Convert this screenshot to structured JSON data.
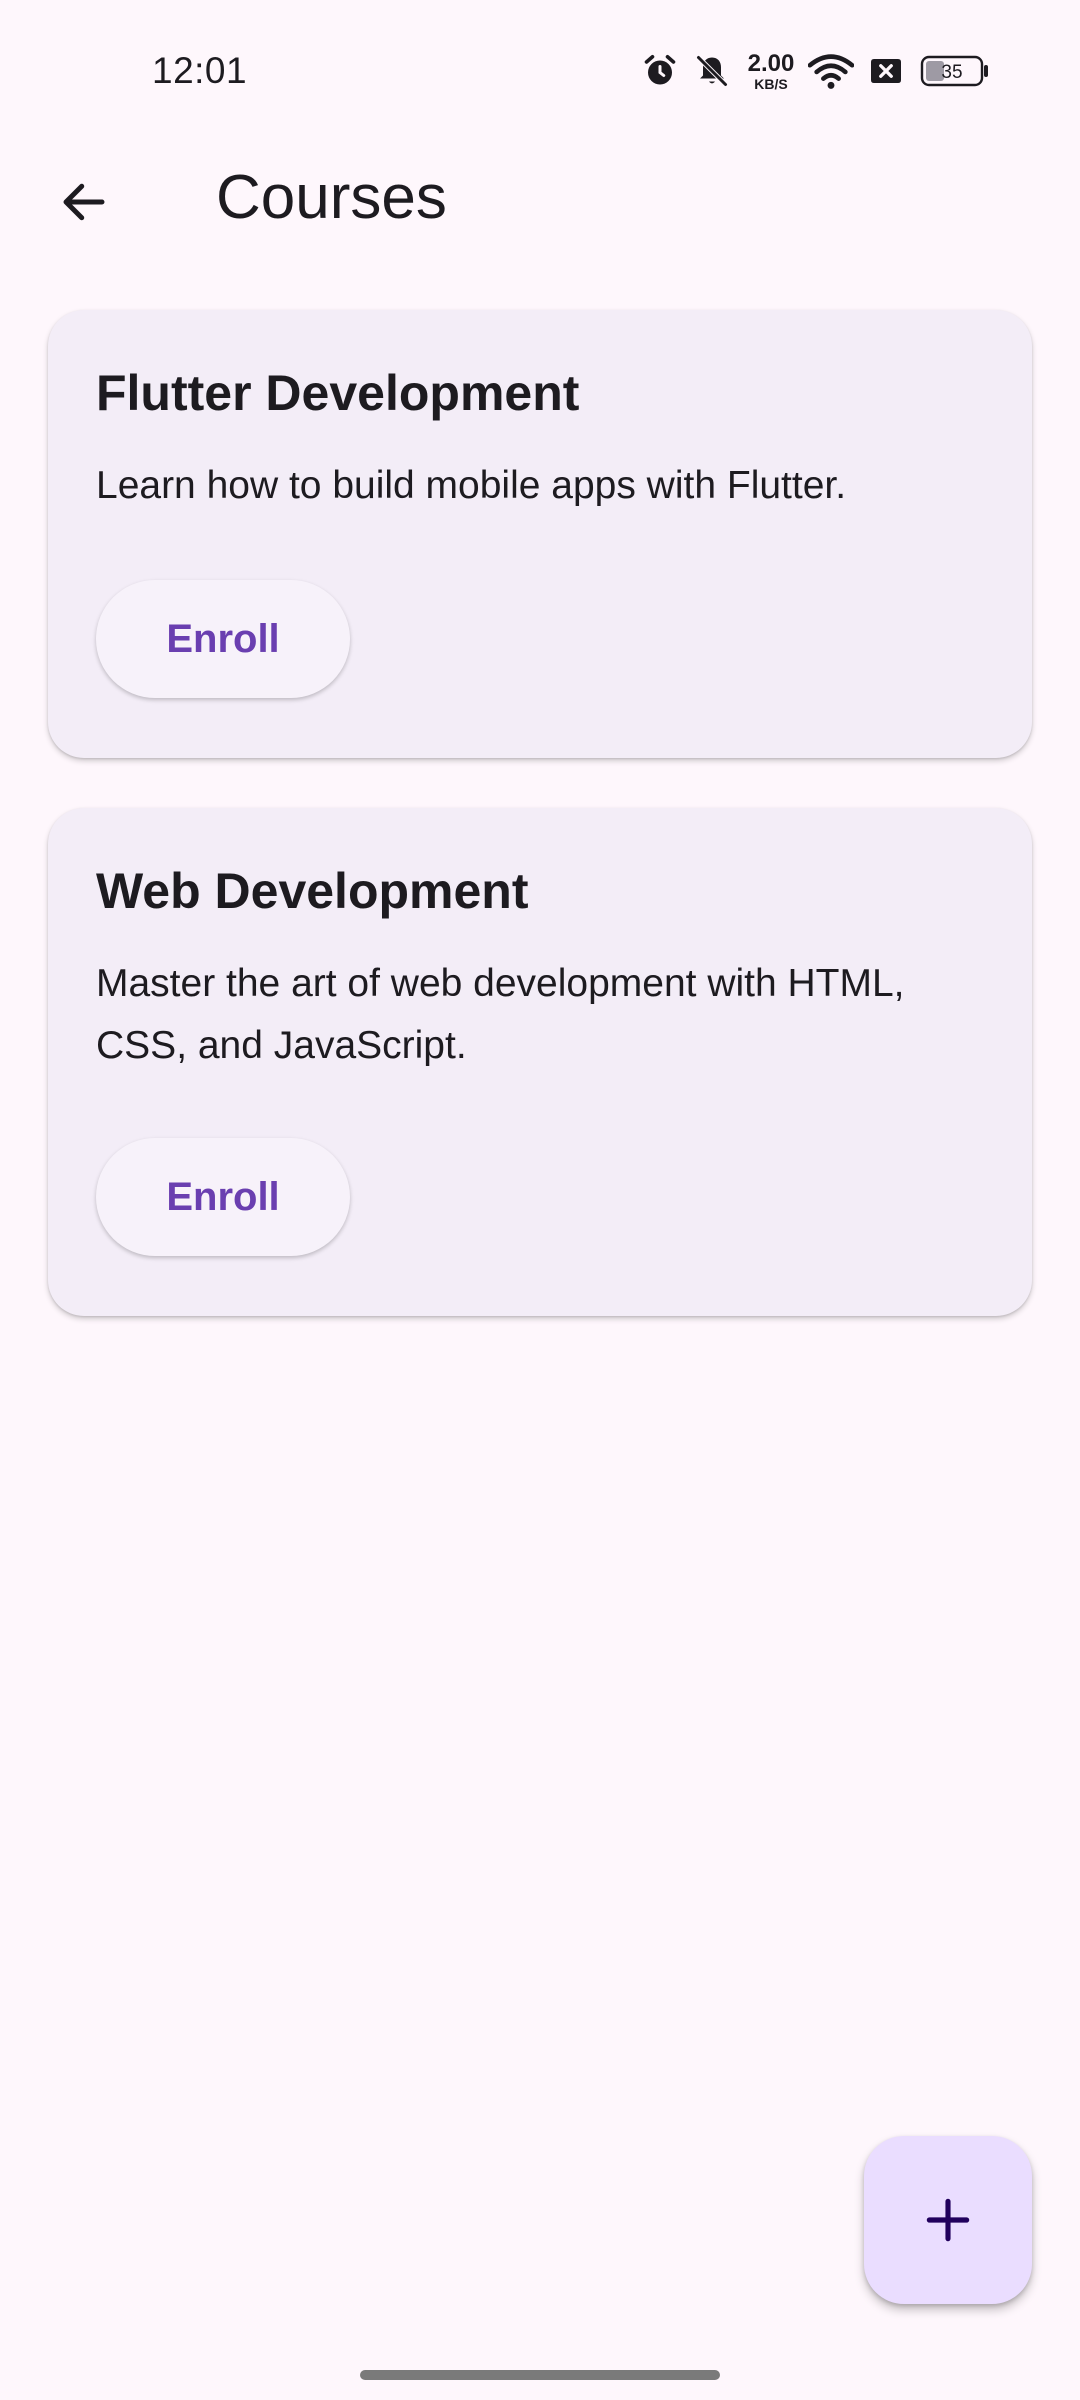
{
  "status_bar": {
    "time": "12:01",
    "network_speed_value": "2.00",
    "network_speed_unit": "KB/S",
    "battery_level": "35",
    "icons": [
      "alarm-icon",
      "bell-off-icon",
      "wifi-icon",
      "sim-x-icon",
      "battery-icon"
    ]
  },
  "app_bar": {
    "title": "Courses",
    "back_icon": "arrow-back-icon"
  },
  "courses": [
    {
      "title": "Flutter Development",
      "description": "Learn how to build mobile apps with Flutter.",
      "button_label": "Enroll"
    },
    {
      "title": "Web Development",
      "description": "Master the art of web development with HTML, CSS, and JavaScript.",
      "button_label": "Enroll"
    }
  ],
  "fab": {
    "icon": "plus-icon"
  },
  "colors": {
    "background": "#fef7fc",
    "card": "#f3edf7",
    "button_text": "#6a3fb0",
    "fab": "#eaddff",
    "fab_icon": "#21005d"
  }
}
